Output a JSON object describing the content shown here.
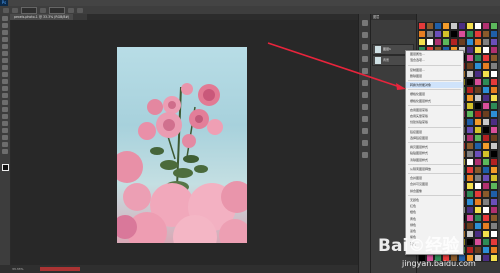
{
  "app": {
    "logo_label": "Ps"
  },
  "tab": {
    "label": "pexels-photo-1 @ 33.3% (RGB/8#)"
  },
  "panel": {
    "header": "图层",
    "layer1": "图层1",
    "layer0": "背景"
  },
  "status": {
    "text": "33.33%"
  },
  "context_menu": {
    "items": [
      "图层属性...",
      "混合选项...",
      "",
      "复制图层...",
      "删除图层",
      "",
      "转换为智能对象",
      "",
      "栅格化图层",
      "栅格化图层样式",
      "",
      "启用图层蒙版",
      "启用矢量蒙版",
      "创建剪贴蒙版",
      "",
      "链接图层",
      "选择链接图层",
      "",
      "拷贝图层样式",
      "粘贴图层样式",
      "清除图层样式",
      "",
      "从隔离图层释放",
      "",
      "合并图层",
      "合并可见图层",
      "拼合图像",
      "",
      "无颜色",
      "红色",
      "橙色",
      "黄色",
      "绿色",
      "蓝色",
      "紫色",
      "灰色"
    ],
    "highlighted_index": 6
  },
  "watermark": {
    "main": "Bai©经验",
    "sub": "jingyan.baidu.com"
  },
  "colors": {
    "accent_arrow": "#e8243c",
    "highlight": "#cfe3fb"
  }
}
